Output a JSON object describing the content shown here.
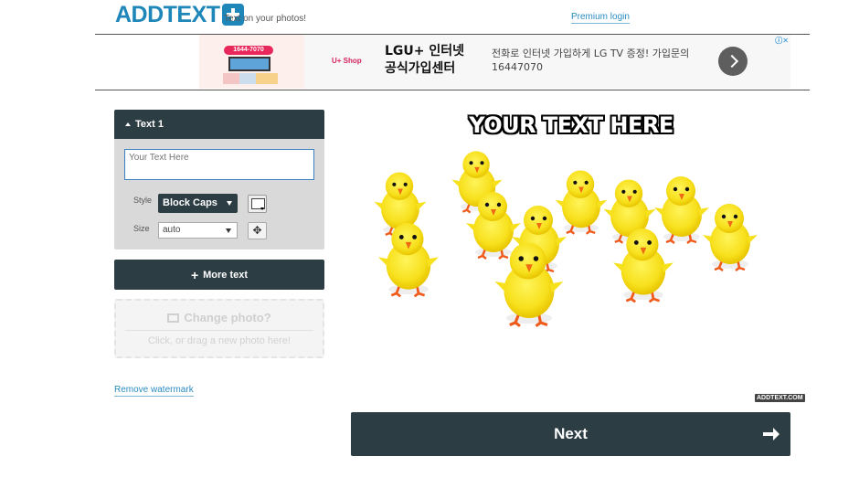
{
  "header": {
    "logo_text": "ADDTEXT",
    "tagline": "Text on your photos!",
    "premium_login": "Premium login"
  },
  "ad": {
    "thumb_phone": "1644-7070",
    "brand": "U+ Shop",
    "title": "LGU+ 인터넷 공식가입센터",
    "body": "전화로 인터넷 가입하게 LG TV 증정! 가입문의 16447070",
    "info_badge": "ⓘ✕"
  },
  "text_panel": {
    "header": "Text 1",
    "textarea_placeholder": "Your Text Here",
    "style_label": "Style",
    "style_value": "Block Caps",
    "size_label": "Size",
    "size_value": "auto"
  },
  "buttons": {
    "more_text": "More text",
    "change_photo_title": "Change photo?",
    "change_photo_sub": "Click, or drag a new photo here!",
    "remove_watermark": "Remove watermark",
    "next": "Next"
  },
  "photo": {
    "overlay_text": "YOUR TEXT HERE",
    "watermark": "ADDTEXT.COM"
  },
  "colors": {
    "brand_blue": "#1e86b8",
    "dark_slate": "#2c3d44",
    "chick_yellow": "#f7e01c"
  }
}
